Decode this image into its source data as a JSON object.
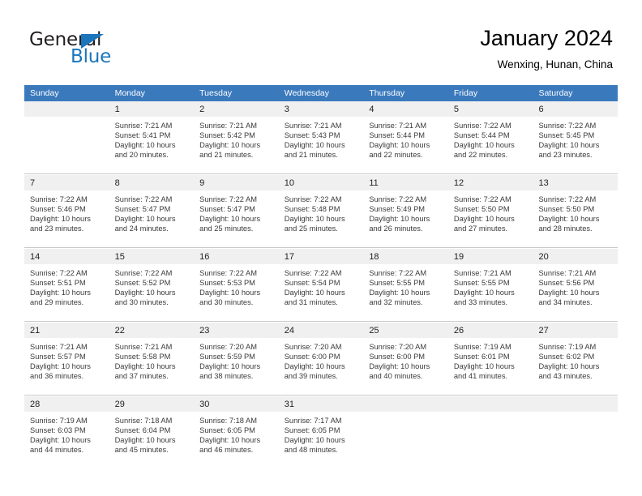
{
  "brand": {
    "name_part1": "General",
    "name_part2": "Blue",
    "accent_color": "#1b75bb"
  },
  "header": {
    "title": "January 2024",
    "subtitle": "Wenxing, Hunan, China",
    "header_bg_color": "#3b79bd"
  },
  "weekdays": [
    "Sunday",
    "Monday",
    "Tuesday",
    "Wednesday",
    "Thursday",
    "Friday",
    "Saturday"
  ],
  "weeks": [
    [
      {
        "day": "",
        "sunrise": "",
        "sunset": "",
        "daylight1": "",
        "daylight2": ""
      },
      {
        "day": "1",
        "sunrise": "Sunrise: 7:21 AM",
        "sunset": "Sunset: 5:41 PM",
        "daylight1": "Daylight: 10 hours",
        "daylight2": "and 20 minutes."
      },
      {
        "day": "2",
        "sunrise": "Sunrise: 7:21 AM",
        "sunset": "Sunset: 5:42 PM",
        "daylight1": "Daylight: 10 hours",
        "daylight2": "and 21 minutes."
      },
      {
        "day": "3",
        "sunrise": "Sunrise: 7:21 AM",
        "sunset": "Sunset: 5:43 PM",
        "daylight1": "Daylight: 10 hours",
        "daylight2": "and 21 minutes."
      },
      {
        "day": "4",
        "sunrise": "Sunrise: 7:21 AM",
        "sunset": "Sunset: 5:44 PM",
        "daylight1": "Daylight: 10 hours",
        "daylight2": "and 22 minutes."
      },
      {
        "day": "5",
        "sunrise": "Sunrise: 7:22 AM",
        "sunset": "Sunset: 5:44 PM",
        "daylight1": "Daylight: 10 hours",
        "daylight2": "and 22 minutes."
      },
      {
        "day": "6",
        "sunrise": "Sunrise: 7:22 AM",
        "sunset": "Sunset: 5:45 PM",
        "daylight1": "Daylight: 10 hours",
        "daylight2": "and 23 minutes."
      }
    ],
    [
      {
        "day": "7",
        "sunrise": "Sunrise: 7:22 AM",
        "sunset": "Sunset: 5:46 PM",
        "daylight1": "Daylight: 10 hours",
        "daylight2": "and 23 minutes."
      },
      {
        "day": "8",
        "sunrise": "Sunrise: 7:22 AM",
        "sunset": "Sunset: 5:47 PM",
        "daylight1": "Daylight: 10 hours",
        "daylight2": "and 24 minutes."
      },
      {
        "day": "9",
        "sunrise": "Sunrise: 7:22 AM",
        "sunset": "Sunset: 5:47 PM",
        "daylight1": "Daylight: 10 hours",
        "daylight2": "and 25 minutes."
      },
      {
        "day": "10",
        "sunrise": "Sunrise: 7:22 AM",
        "sunset": "Sunset: 5:48 PM",
        "daylight1": "Daylight: 10 hours",
        "daylight2": "and 25 minutes."
      },
      {
        "day": "11",
        "sunrise": "Sunrise: 7:22 AM",
        "sunset": "Sunset: 5:49 PM",
        "daylight1": "Daylight: 10 hours",
        "daylight2": "and 26 minutes."
      },
      {
        "day": "12",
        "sunrise": "Sunrise: 7:22 AM",
        "sunset": "Sunset: 5:50 PM",
        "daylight1": "Daylight: 10 hours",
        "daylight2": "and 27 minutes."
      },
      {
        "day": "13",
        "sunrise": "Sunrise: 7:22 AM",
        "sunset": "Sunset: 5:50 PM",
        "daylight1": "Daylight: 10 hours",
        "daylight2": "and 28 minutes."
      }
    ],
    [
      {
        "day": "14",
        "sunrise": "Sunrise: 7:22 AM",
        "sunset": "Sunset: 5:51 PM",
        "daylight1": "Daylight: 10 hours",
        "daylight2": "and 29 minutes."
      },
      {
        "day": "15",
        "sunrise": "Sunrise: 7:22 AM",
        "sunset": "Sunset: 5:52 PM",
        "daylight1": "Daylight: 10 hours",
        "daylight2": "and 30 minutes."
      },
      {
        "day": "16",
        "sunrise": "Sunrise: 7:22 AM",
        "sunset": "Sunset: 5:53 PM",
        "daylight1": "Daylight: 10 hours",
        "daylight2": "and 30 minutes."
      },
      {
        "day": "17",
        "sunrise": "Sunrise: 7:22 AM",
        "sunset": "Sunset: 5:54 PM",
        "daylight1": "Daylight: 10 hours",
        "daylight2": "and 31 minutes."
      },
      {
        "day": "18",
        "sunrise": "Sunrise: 7:22 AM",
        "sunset": "Sunset: 5:55 PM",
        "daylight1": "Daylight: 10 hours",
        "daylight2": "and 32 minutes."
      },
      {
        "day": "19",
        "sunrise": "Sunrise: 7:21 AM",
        "sunset": "Sunset: 5:55 PM",
        "daylight1": "Daylight: 10 hours",
        "daylight2": "and 33 minutes."
      },
      {
        "day": "20",
        "sunrise": "Sunrise: 7:21 AM",
        "sunset": "Sunset: 5:56 PM",
        "daylight1": "Daylight: 10 hours",
        "daylight2": "and 34 minutes."
      }
    ],
    [
      {
        "day": "21",
        "sunrise": "Sunrise: 7:21 AM",
        "sunset": "Sunset: 5:57 PM",
        "daylight1": "Daylight: 10 hours",
        "daylight2": "and 36 minutes."
      },
      {
        "day": "22",
        "sunrise": "Sunrise: 7:21 AM",
        "sunset": "Sunset: 5:58 PM",
        "daylight1": "Daylight: 10 hours",
        "daylight2": "and 37 minutes."
      },
      {
        "day": "23",
        "sunrise": "Sunrise: 7:20 AM",
        "sunset": "Sunset: 5:59 PM",
        "daylight1": "Daylight: 10 hours",
        "daylight2": "and 38 minutes."
      },
      {
        "day": "24",
        "sunrise": "Sunrise: 7:20 AM",
        "sunset": "Sunset: 6:00 PM",
        "daylight1": "Daylight: 10 hours",
        "daylight2": "and 39 minutes."
      },
      {
        "day": "25",
        "sunrise": "Sunrise: 7:20 AM",
        "sunset": "Sunset: 6:00 PM",
        "daylight1": "Daylight: 10 hours",
        "daylight2": "and 40 minutes."
      },
      {
        "day": "26",
        "sunrise": "Sunrise: 7:19 AM",
        "sunset": "Sunset: 6:01 PM",
        "daylight1": "Daylight: 10 hours",
        "daylight2": "and 41 minutes."
      },
      {
        "day": "27",
        "sunrise": "Sunrise: 7:19 AM",
        "sunset": "Sunset: 6:02 PM",
        "daylight1": "Daylight: 10 hours",
        "daylight2": "and 43 minutes."
      }
    ],
    [
      {
        "day": "28",
        "sunrise": "Sunrise: 7:19 AM",
        "sunset": "Sunset: 6:03 PM",
        "daylight1": "Daylight: 10 hours",
        "daylight2": "and 44 minutes."
      },
      {
        "day": "29",
        "sunrise": "Sunrise: 7:18 AM",
        "sunset": "Sunset: 6:04 PM",
        "daylight1": "Daylight: 10 hours",
        "daylight2": "and 45 minutes."
      },
      {
        "day": "30",
        "sunrise": "Sunrise: 7:18 AM",
        "sunset": "Sunset: 6:05 PM",
        "daylight1": "Daylight: 10 hours",
        "daylight2": "and 46 minutes."
      },
      {
        "day": "31",
        "sunrise": "Sunrise: 7:17 AM",
        "sunset": "Sunset: 6:05 PM",
        "daylight1": "Daylight: 10 hours",
        "daylight2": "and 48 minutes."
      },
      {
        "day": "",
        "sunrise": "",
        "sunset": "",
        "daylight1": "",
        "daylight2": ""
      },
      {
        "day": "",
        "sunrise": "",
        "sunset": "",
        "daylight1": "",
        "daylight2": ""
      },
      {
        "day": "",
        "sunrise": "",
        "sunset": "",
        "daylight1": "",
        "daylight2": ""
      }
    ]
  ]
}
